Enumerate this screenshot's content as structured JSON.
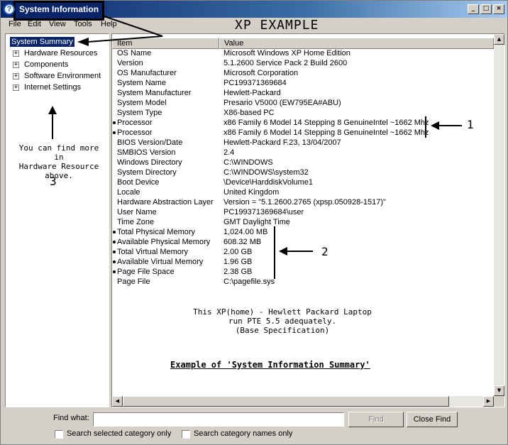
{
  "window": {
    "title": "System Information",
    "icon": "help-info-icon",
    "controls": {
      "minimize": "_",
      "maximize": "□",
      "close": "×"
    }
  },
  "menu": [
    "File",
    "Edit",
    "View",
    "Tools",
    "Help"
  ],
  "heading": "XP  EXAMPLE",
  "tree": {
    "selected": "System Summary",
    "items": [
      "Hardware Resources",
      "Components",
      "Software Environment",
      "Internet Settings"
    ],
    "expander": "+",
    "note": [
      "You can find more in",
      "Hardware Resource",
      "above."
    ],
    "note_number": "3"
  },
  "list": {
    "headers": [
      "Item",
      "Value"
    ],
    "rows": [
      {
        "item": "OS Name",
        "value": "Microsoft Windows XP Home Edition",
        "bullet": false
      },
      {
        "item": "Version",
        "value": "5.1.2600 Service Pack 2 Build 2600",
        "bullet": false
      },
      {
        "item": "OS Manufacturer",
        "value": "Microsoft Corporation",
        "bullet": false
      },
      {
        "item": "System Name",
        "value": "PC199371369684",
        "bullet": false
      },
      {
        "item": "System Manufacturer",
        "value": "Hewlett-Packard",
        "bullet": false
      },
      {
        "item": "System Model",
        "value": "Presario V5000 (EW795EA#ABU)",
        "bullet": false
      },
      {
        "item": "System Type",
        "value": "X86-based PC",
        "bullet": false
      },
      {
        "item": "Processor",
        "value": "x86 Family 6 Model 14 Stepping 8 GenuineIntel ~1662 Mhz",
        "bullet": true
      },
      {
        "item": "Processor",
        "value": "x86 Family 6 Model 14 Stepping 8 GenuineIntel ~1662 Mhz",
        "bullet": true
      },
      {
        "item": "BIOS Version/Date",
        "value": "Hewlett-Packard F.23, 13/04/2007",
        "bullet": false
      },
      {
        "item": "SMBIOS Version",
        "value": "2.4",
        "bullet": false
      },
      {
        "item": "Windows Directory",
        "value": "C:\\WINDOWS",
        "bullet": false
      },
      {
        "item": "System Directory",
        "value": "C:\\WINDOWS\\system32",
        "bullet": false
      },
      {
        "item": "Boot Device",
        "value": "\\Device\\HarddiskVolume1",
        "bullet": false
      },
      {
        "item": "Locale",
        "value": "United Kingdom",
        "bullet": false
      },
      {
        "item": "Hardware Abstraction Layer",
        "value": "Version = \"5.1.2600.2765 (xpsp.050928-1517)\"",
        "bullet": false
      },
      {
        "item": "User Name",
        "value": "PC199371369684\\user",
        "bullet": false
      },
      {
        "item": "Time Zone",
        "value": "GMT Daylight Time",
        "bullet": false
      },
      {
        "item": "Total Physical Memory",
        "value": "1,024.00 MB",
        "bullet": true
      },
      {
        "item": "Available Physical Memory",
        "value": "608.32 MB",
        "bullet": true
      },
      {
        "item": "Total Virtual Memory",
        "value": "2.00 GB",
        "bullet": true
      },
      {
        "item": "Available Virtual Memory",
        "value": "1.96 GB",
        "bullet": true
      },
      {
        "item": "Page File Space",
        "value": "2.38 GB",
        "bullet": true
      },
      {
        "item": "Page File",
        "value": "C:\\pagefile.sys",
        "bullet": false
      }
    ],
    "note": [
      "This XP(home) - Hewlett Packard Laptop",
      "run PTE 5.5 adequately.",
      "(Base Specification)"
    ],
    "caption": "Example of 'System Information Summary'",
    "annotation_1": "1",
    "annotation_2": "2"
  },
  "scrollbar": {
    "up": "▲",
    "down": "▼",
    "left": "◀",
    "right": "▶"
  },
  "find": {
    "label": "Find what:",
    "value": "",
    "find_button": "Find",
    "close_button": "Close Find",
    "option_selected": "Search selected category only",
    "option_names": "Search category names only"
  }
}
